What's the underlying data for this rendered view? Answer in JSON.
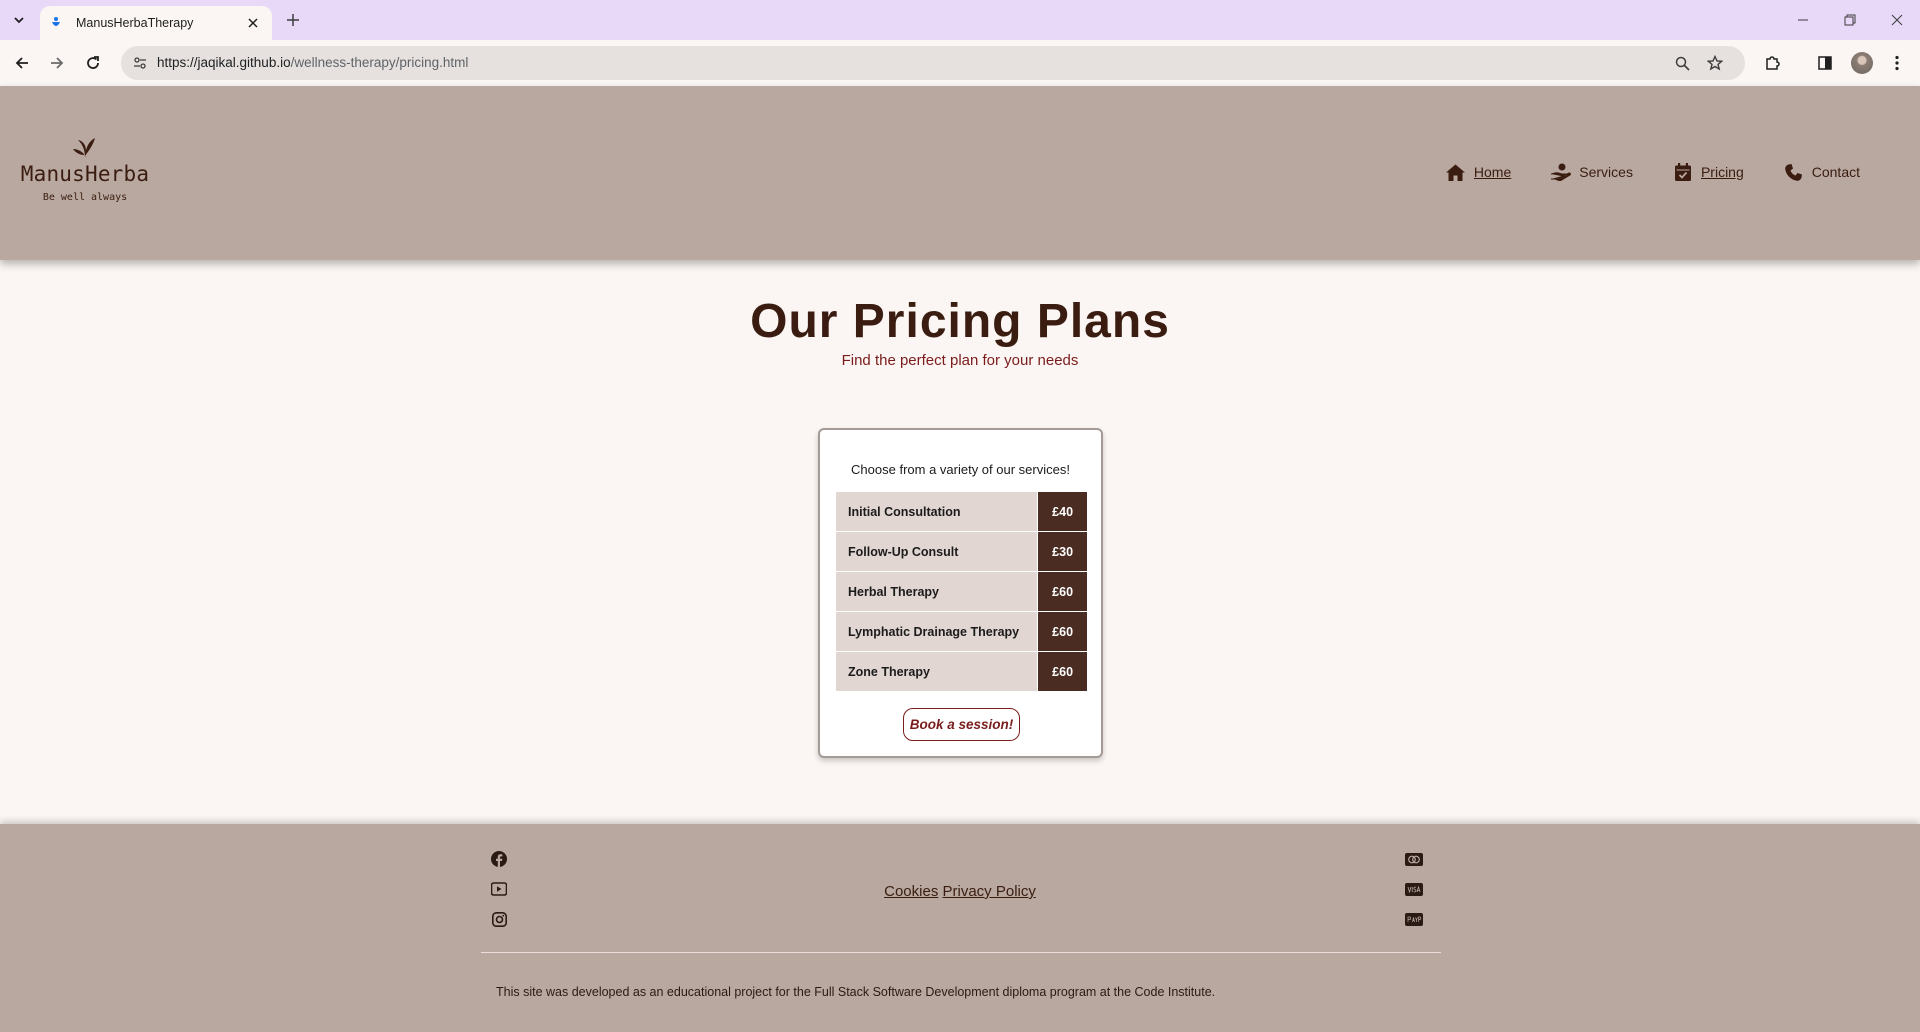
{
  "browser": {
    "tab_title": "ManusHerbaTherapy",
    "url_host": "https://jaqikal.github.io",
    "url_path": "/wellness-therapy/pricing.html"
  },
  "header": {
    "brand_name": "ManusHerba",
    "brand_tagline": "Be well always",
    "nav": [
      {
        "label": "Home",
        "icon": "house-icon"
      },
      {
        "label": "Services",
        "icon": "hand-icon"
      },
      {
        "label": "Pricing",
        "icon": "calendar-check-icon"
      },
      {
        "label": "Contact",
        "icon": "phone-icon"
      }
    ]
  },
  "main": {
    "title": "Our Pricing Plans",
    "subtitle": "Find the perfect plan for your needs",
    "card_intro": "Choose from a variety of our services!",
    "prices": [
      {
        "service": "Initial Consultation",
        "price": "£40"
      },
      {
        "service": "Follow-Up Consult",
        "price": "£30"
      },
      {
        "service": "Herbal Therapy",
        "price": "£60"
      },
      {
        "service": "Lymphatic Drainage Therapy",
        "price": "£60"
      },
      {
        "service": "Zone Therapy",
        "price": "£60"
      }
    ],
    "book_label": "Book a session!"
  },
  "footer": {
    "social": [
      "facebook-icon",
      "youtube-icon",
      "instagram-icon"
    ],
    "payments": [
      "mastercard-icon",
      "visa-icon",
      "paypal-icon"
    ],
    "cookies_label": "Cookies",
    "privacy_label": "Privacy Policy",
    "credit": "This site was developed as an educational project for the Full Stack Software Development diploma program at the Code Institute."
  },
  "colors": {
    "header_bg": "#b9a8a0",
    "brand_dark": "#3a1d10",
    "accent_red": "#7a1c1c",
    "price_cell": "#4b2c22",
    "service_cell": "#e1d6d2",
    "page_bg": "#fbf6f3"
  }
}
